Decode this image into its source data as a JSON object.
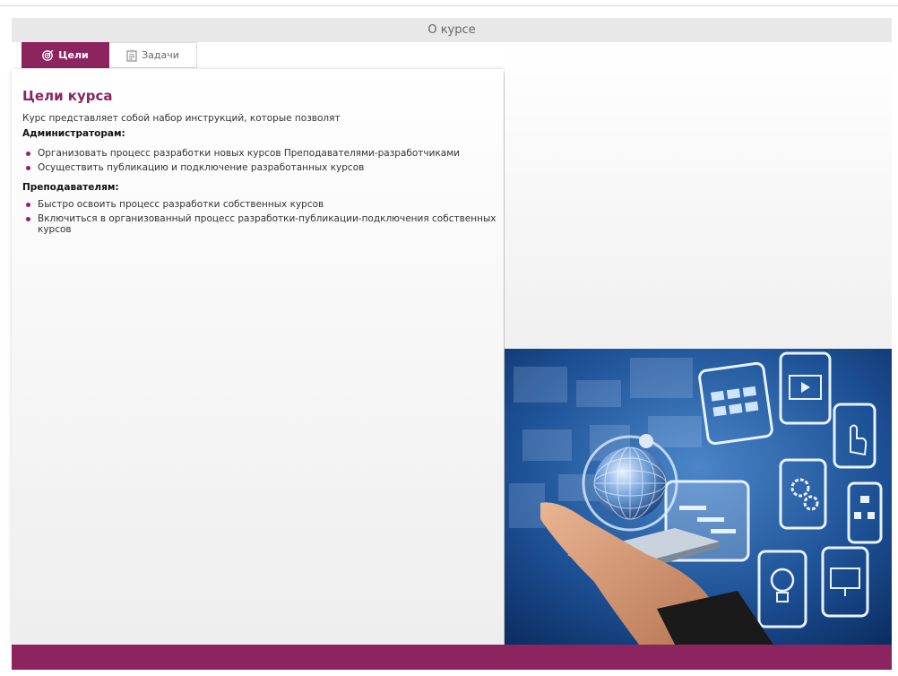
{
  "header": {
    "title": "О курсе"
  },
  "tabs": [
    {
      "label": "Цели",
      "icon": "target-icon",
      "active": true
    },
    {
      "label": "Задачи",
      "icon": "clipboard-icon",
      "active": false
    }
  ],
  "content": {
    "heading": "Цели курса",
    "intro": "Курс представляет собой набор инструкций, которые позволят",
    "groups": [
      {
        "title": "Администраторам:",
        "items": [
          "Организовать процесс разработки новых курсов Преподавателями-разработчиками",
          "Осуществить публикацию и подключение разработанных курсов"
        ]
      },
      {
        "title": "Преподавателям:",
        "items": [
          "Быстро освоить процесс разработки собственных курсов",
          "Включиться в организованный процесс разработки-публикации-подключения собственных курсов"
        ]
      }
    ]
  },
  "colors": {
    "accent": "#8c2460",
    "title_bar": "#e8e8e8",
    "hero_bg": "#0e3a7a"
  },
  "hero": {
    "icons": [
      "video-card-icon",
      "play-icon",
      "globe-icon",
      "touch-icon",
      "gears-icon",
      "flowchart-icon",
      "gantt-icon",
      "lightbulb-icon",
      "monitor-icon"
    ]
  }
}
